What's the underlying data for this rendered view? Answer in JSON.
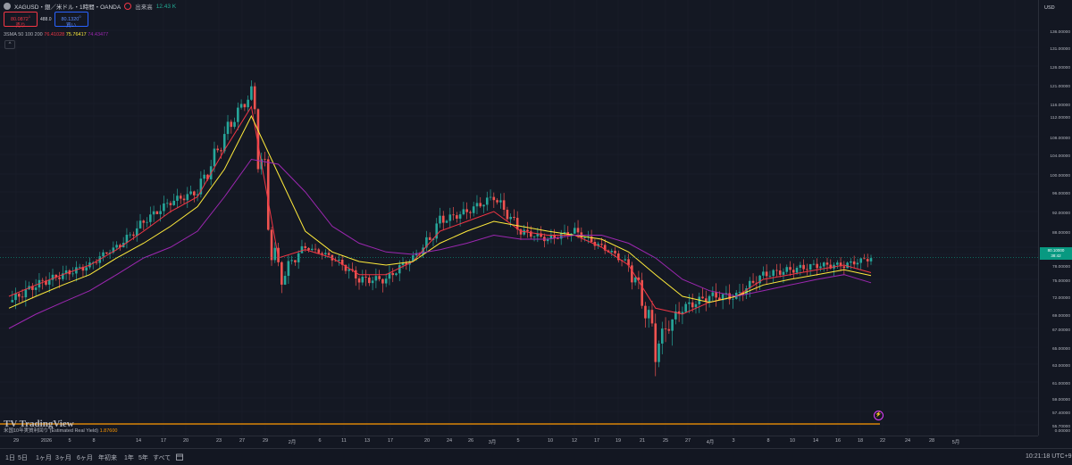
{
  "header": {
    "symbol": "XAGUSD・銀／米ドル・1時間・OANDA",
    "volume_label": "出来高",
    "volume_value": "12.43 K"
  },
  "trade": {
    "sell_price": "80.0872",
    "sell_sup": "1",
    "sell_label": "売り",
    "spread": "488.0",
    "buy_price": "80.1320",
    "buy_sup": "0",
    "buy_label": "買い"
  },
  "indicator": {
    "name": "3SMA 50 100 200",
    "v1": "76.41028",
    "v2": "75.76417",
    "v3": "74.43477",
    "colors": [
      "#f23645",
      "#ffeb3b",
      "#9c27b0"
    ]
  },
  "watermark": "TV TradingView",
  "sub_indicator": {
    "name": "米国10年実質利回り (Estimated Real Yield)",
    "value": "1.87600"
  },
  "price_axis": {
    "currency": "USD",
    "current_price": "80.10000",
    "countdown": "38:42",
    "ticks": [
      "136.00000",
      "131.00000",
      "126.00000",
      "121.00000",
      "116.00000",
      "112.00000",
      "108.00000",
      "104.00000",
      "100.00000",
      "96.00000",
      "92.00000",
      "88.00000",
      "84.00000",
      "81.00000",
      "78.00000",
      "75.00000",
      "72.00000",
      "69.00000",
      "67.00000",
      "65.00000",
      "63.00000",
      "61.00000",
      "59.00000",
      "57.40000",
      "55.70000",
      "0.00000"
    ]
  },
  "time_axis": {
    "labels": [
      "29",
      "2026",
      "5",
      "8",
      "14",
      "17",
      "20",
      "23",
      "27",
      "29",
      "2月",
      "6",
      "11",
      "13",
      "17",
      "20",
      "24",
      "26",
      "3月",
      "5",
      "10",
      "12",
      "17",
      "19",
      "21",
      "25",
      "27",
      "4月",
      "3",
      "8",
      "10",
      "14",
      "16",
      "18",
      "22",
      "24",
      "28",
      "5月"
    ]
  },
  "bottom_bar": {
    "ranges": [
      "1日",
      "5日",
      "1ヶ月",
      "3ヶ月",
      "6ヶ月",
      "年初来",
      "1年",
      "5年",
      "すべて"
    ],
    "clock": "10:21:18 UTC+9"
  },
  "chart_data": {
    "type": "line",
    "title": "XAGUSD・銀／米ドル・1時間・OANDA",
    "ylabel": "USD",
    "x": [
      "29",
      "2026",
      "5",
      "8",
      "14",
      "17",
      "20",
      "23",
      "27",
      "29",
      "2月",
      "6",
      "11",
      "13",
      "17",
      "20",
      "24",
      "26",
      "3月",
      "5",
      "10",
      "12",
      "17",
      "19",
      "21",
      "25",
      "27",
      "4月",
      "3",
      "8",
      "10",
      "14",
      "16"
    ],
    "series": [
      {
        "name": "XAGUSD",
        "values": [
          71,
          74,
          76,
          78,
          84,
          90,
          94,
          96,
          108,
          119,
          74,
          84,
          80,
          75,
          75,
          80,
          90,
          92,
          95,
          88,
          86,
          88,
          84,
          78,
          65,
          70,
          72,
          72,
          76,
          77,
          78,
          78,
          80
        ]
      },
      {
        "name": "SMA 50",
        "values": [
          72,
          74,
          76,
          78,
          83,
          88,
          92,
          95,
          105,
          115,
          80,
          83,
          80,
          76,
          76,
          79,
          88,
          90,
          92,
          88,
          87,
          87,
          84,
          78,
          70,
          69,
          71,
          72,
          75,
          76,
          77,
          78,
          76.4
        ]
      },
      {
        "name": "SMA 100",
        "values": [
          70,
          72,
          74,
          76,
          80,
          85,
          89,
          93,
          101,
          112,
          100,
          88,
          82,
          79,
          78,
          79,
          85,
          88,
          90,
          89,
          88,
          87,
          86,
          82,
          76,
          72,
          71,
          72,
          74,
          75,
          76,
          77,
          75.8
        ]
      },
      {
        "name": "SMA 200",
        "values": [
          67,
          69,
          71,
          73,
          76,
          80,
          84,
          88,
          95,
          103,
          102,
          96,
          89,
          85,
          82,
          81,
          83,
          85,
          87,
          86,
          86,
          87,
          87,
          85,
          80,
          75,
          73,
          72,
          73,
          74,
          75,
          76,
          74.4
        ]
      }
    ],
    "ylim": [
      55.7,
      136
    ],
    "current_price": 80.1,
    "grid": true,
    "legend": "top-left"
  }
}
